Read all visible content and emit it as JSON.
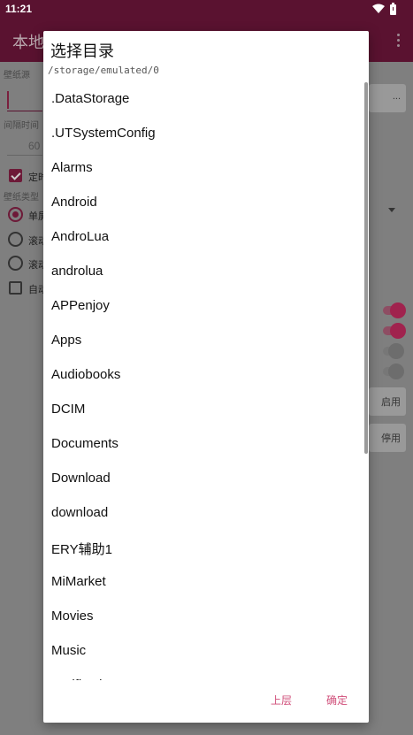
{
  "status_bar": {
    "time": "11:21",
    "wifi_icon": "wifi-icon",
    "battery_icon": "battery-icon"
  },
  "background": {
    "app_title": "本地",
    "labels": {
      "wallpaper_source": "壁纸源",
      "interval": "间隔时间",
      "wallpaper_type": "壁纸类型"
    },
    "interval_value": "60",
    "browse_button": "...",
    "enable_button": "启用",
    "disable_button": "停用",
    "timed_checkbox": "定时",
    "options": [
      "单屏",
      "滚动",
      "滚动",
      "自动"
    ]
  },
  "dialog": {
    "title": "选择目录",
    "path": "/storage/emulated/0",
    "items": [
      ".DataStorage",
      ".UTSystemConfig",
      "Alarms",
      "Android",
      "AndroLua",
      "androlua",
      "APPenjoy",
      "Apps",
      "Audiobooks",
      "DCIM",
      "Documents",
      "Download",
      "download",
      "ERY辅助1",
      "MiMarket",
      "Movies",
      "Music",
      "Notifications"
    ],
    "buttons": {
      "up": "上层",
      "confirm": "确定"
    }
  },
  "colors": {
    "accent": "#d04f7a",
    "app_bar": "#5a1230",
    "scrim": "#7d7d7d"
  }
}
